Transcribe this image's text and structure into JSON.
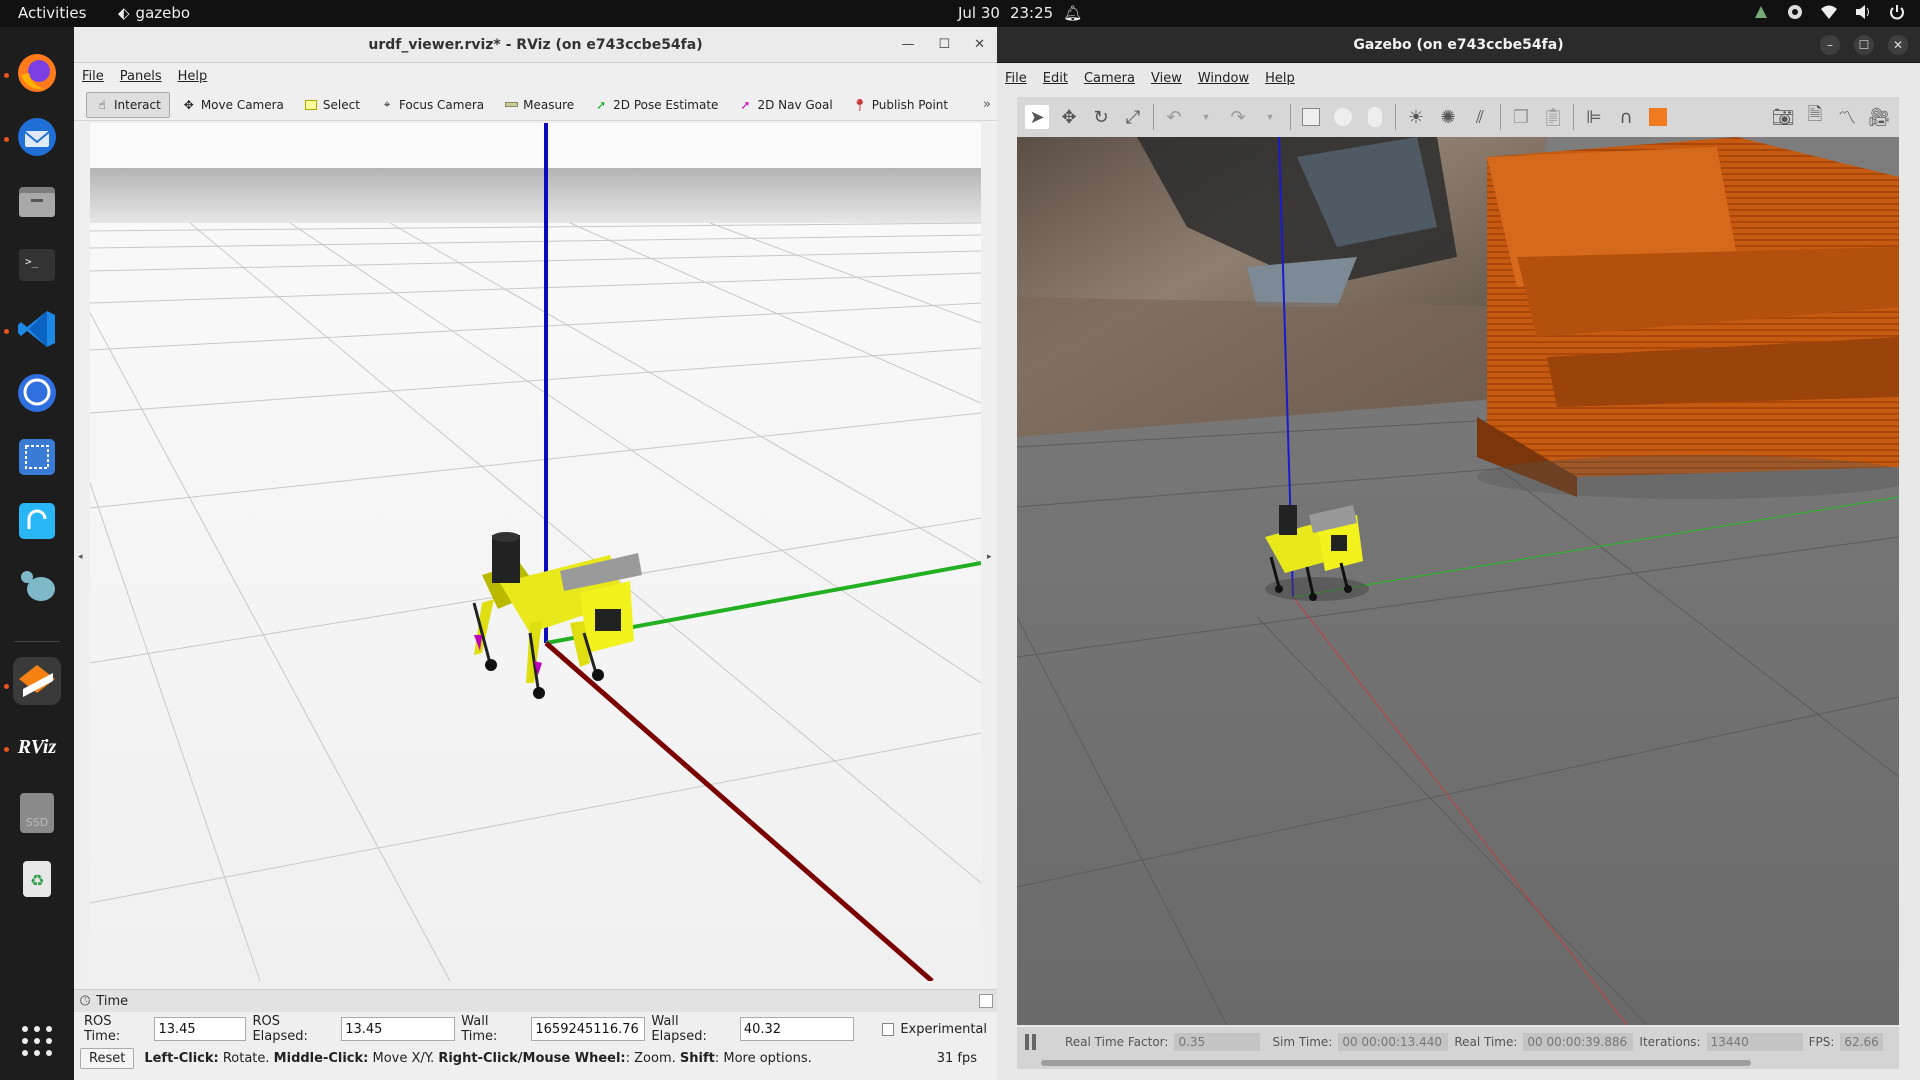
{
  "topbar": {
    "activities": "Activities",
    "app_name": "gazebo",
    "date": "Jul 30",
    "time": "23:25"
  },
  "dock": {
    "items": [
      "firefox-icon",
      "thunderbird-icon",
      "files-icon",
      "terminal-icon",
      "vscode-icon",
      "signal-icon",
      "screenshot-icon",
      "remmina-icon",
      "mysql-workbench-icon",
      "gazebo-icon",
      "rviz-icon",
      "ssd-icon",
      "trash-icon",
      "app-grid-icon"
    ],
    "rviz_label": "RViz",
    "ssd_label": "SSD"
  },
  "rviz": {
    "title": "urdf_viewer.rviz* - RViz (on e743ccbe54fa)",
    "menu": [
      "File",
      "Panels",
      "Help"
    ],
    "tools": [
      "Interact",
      "Move Camera",
      "Select",
      "Focus Camera",
      "Measure",
      "2D Pose Estimate",
      "2D Nav Goal",
      "Publish Point"
    ],
    "time_panel": {
      "title": "Time",
      "ros_time_label": "ROS Time:",
      "ros_time": "13.45",
      "ros_elapsed_label": "ROS Elapsed:",
      "ros_elapsed": "13.45",
      "wall_time_label": "Wall Time:",
      "wall_time": "1659245116.76",
      "wall_elapsed_label": "Wall Elapsed:",
      "wall_elapsed": "40.32",
      "experimental": "Experimental"
    },
    "reset": "Reset",
    "hint": {
      "left": "Left-Click:",
      "left_t": " Rotate. ",
      "middle": "Middle-Click:",
      "middle_t": " Move X/Y. ",
      "right": "Right-Click/Mouse Wheel:",
      "right_t": ": Zoom. ",
      "shift": "Shift",
      "shift_t": ": More options."
    },
    "fps": "31 fps"
  },
  "gazebo": {
    "title": "Gazebo (on e743ccbe54fa)",
    "menu": [
      "File",
      "Edit",
      "Camera",
      "View",
      "Window",
      "Help"
    ],
    "status": {
      "rtf_label": "Real Time Factor:",
      "rtf": "0.35",
      "sim_label": "Sim Time:",
      "sim": "00 00:00:13.440",
      "real_label": "Real Time:",
      "real": "00 00:00:39.886",
      "iter_label": "Iterations:",
      "iter": "13440",
      "fps_label": "FPS:",
      "fps": "62.66"
    }
  },
  "colors": {
    "axis_x": "#8b0000",
    "axis_y": "#22b022",
    "axis_z": "#0b0bbd",
    "robot": "#e8e81a",
    "building": "#c65a10"
  }
}
